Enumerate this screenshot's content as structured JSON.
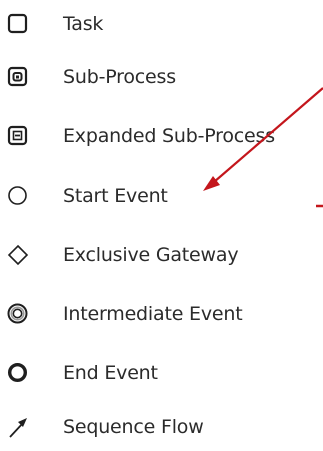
{
  "palette": {
    "text": "#2b2b2b",
    "icon": "#1f1f1f",
    "annotation_arrow": "#c4161c"
  },
  "menu": {
    "items": [
      {
        "label": "Task",
        "icon": "task-icon"
      },
      {
        "label": "Sub-Process",
        "icon": "sub-process-icon"
      },
      {
        "label": "Expanded Sub-Process",
        "icon": "expanded-sub-process-icon"
      },
      {
        "label": "Start Event",
        "icon": "start-event-icon"
      },
      {
        "label": "Exclusive Gateway",
        "icon": "exclusive-gateway-icon"
      },
      {
        "label": "Intermediate Event",
        "icon": "intermediate-event-icon"
      },
      {
        "label": "End Event",
        "icon": "end-event-icon"
      },
      {
        "label": "Sequence Flow",
        "icon": "sequence-flow-icon"
      }
    ]
  }
}
